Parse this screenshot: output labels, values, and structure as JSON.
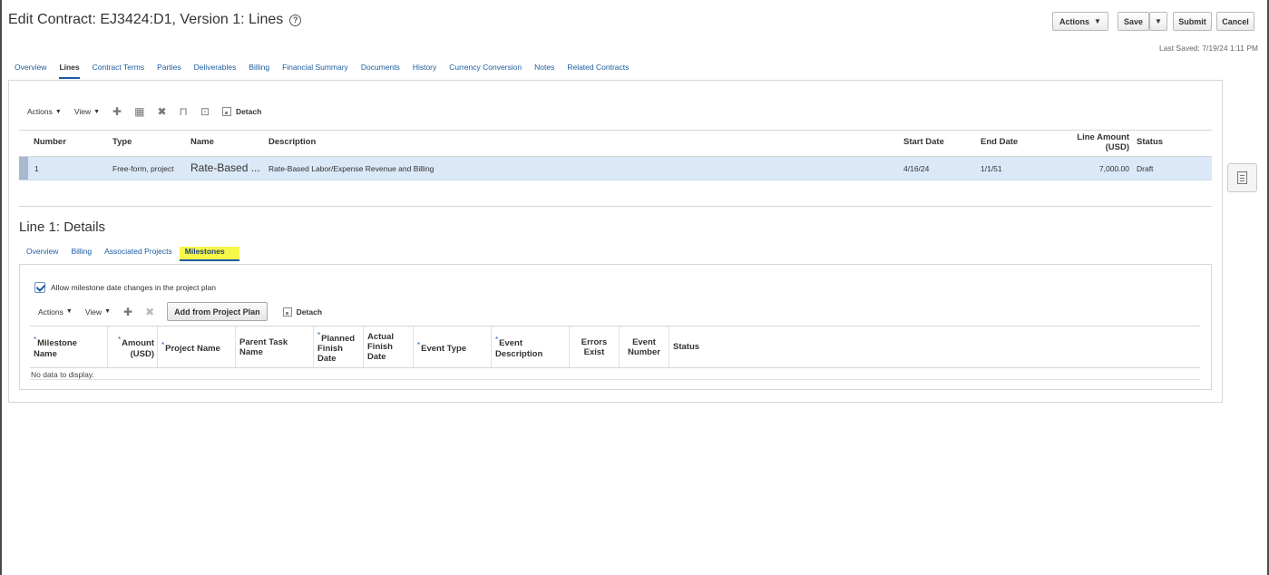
{
  "page": {
    "title": "Edit Contract: EJ3424:D1, Version 1: Lines",
    "help_icon": "?"
  },
  "header_buttons": {
    "actions": "Actions",
    "save": "Save",
    "submit": "Submit",
    "cancel": "Cancel",
    "caret": "▼"
  },
  "last_saved": "Last Saved: 7/19/24 1:11 PM",
  "main_tabs": [
    "Overview",
    "Lines",
    "Contract Terms",
    "Parties",
    "Deliverables",
    "Billing",
    "Financial Summary",
    "Documents",
    "History",
    "Currency Conversion",
    "Notes",
    "Related Contracts"
  ],
  "lines_toolbar": {
    "actions": "Actions",
    "view": "View",
    "detach": "Detach",
    "caret": "▼",
    "icons": [
      "add-icon",
      "table-icon",
      "delete-icon",
      "split-icon",
      "export-icon"
    ]
  },
  "lines_table": {
    "headers": {
      "number": "Number",
      "type": "Type",
      "name": "Name",
      "description": "Description",
      "start_date": "Start Date",
      "end_date": "End Date",
      "line_amount": "Line Amount",
      "line_amount_unit": "(USD)",
      "status": "Status"
    },
    "row": {
      "number": "1",
      "type": "Free-form, project",
      "name": "Rate-Based ...",
      "description": "Rate-Based Labor/Expense Revenue and Billing",
      "start_date": "4/16/24",
      "end_date": "1/1/51",
      "line_amount": "7,000.00",
      "status": "Draft"
    }
  },
  "details": {
    "title": "Line 1: Details",
    "tabs": [
      "Overview",
      "Billing",
      "Associated Projects",
      "Milestones"
    ],
    "checkbox_label": "Allow milestone date changes in the project plan"
  },
  "ms_toolbar": {
    "actions": "Actions",
    "view": "View",
    "add_from_plan": "Add from Project Plan",
    "detach": "Detach",
    "caret": "▼"
  },
  "ms_table": {
    "required_mark": "*",
    "headers": {
      "milestone_name_1": "Milestone",
      "milestone_name_2": "Name",
      "amount_1": "Amount",
      "amount_2": "(USD)",
      "project_name": "Project Name",
      "parent_task_1": "Parent Task",
      "parent_task_2": "Name",
      "planned_1": "Planned",
      "planned_2": "Finish",
      "planned_3": "Date",
      "actual_1": "Actual",
      "actual_2": "Finish",
      "actual_3": "Date",
      "event_type": "Event Type",
      "event_desc_1": "Event",
      "event_desc_2": "Description",
      "errors_1": "Errors",
      "errors_2": "Exist",
      "event_number_1": "Event",
      "event_number_2": "Number",
      "status": "Status"
    },
    "empty_text": "No data to display."
  },
  "colors": {
    "link": "#1c5a9e",
    "selected_row": "#dbe8f7",
    "highlight": "#f7f74a"
  }
}
